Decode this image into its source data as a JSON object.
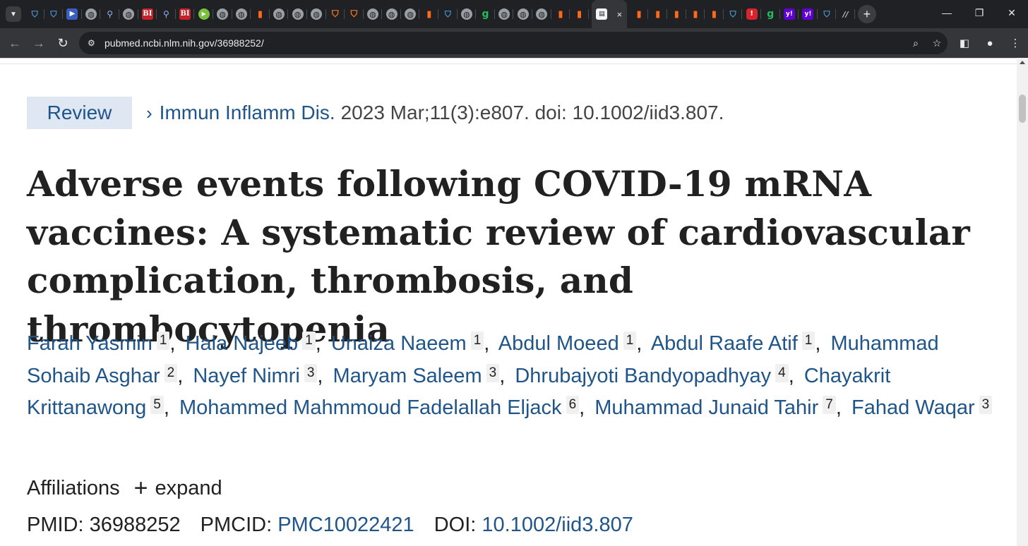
{
  "browser": {
    "tabs": [
      {
        "icon": "shield-icon"
      },
      {
        "icon": "shield-icon"
      },
      {
        "icon": "bookmark-blue-icon"
      },
      {
        "icon": "globe-icon"
      },
      {
        "icon": "search-icon"
      },
      {
        "icon": "globe-icon"
      },
      {
        "icon": "bi-logo-icon"
      },
      {
        "icon": "search-icon"
      },
      {
        "icon": "bi-logo-icon"
      },
      {
        "icon": "play-icon"
      },
      {
        "icon": "globe-icon"
      },
      {
        "icon": "globe-icon"
      },
      {
        "icon": "bookmark-orange-icon"
      },
      {
        "icon": "globe-icon"
      },
      {
        "icon": "globe-icon"
      },
      {
        "icon": "globe-icon"
      },
      {
        "icon": "shield-orange-icon"
      },
      {
        "icon": "shield-orange-icon"
      },
      {
        "icon": "globe-icon"
      },
      {
        "icon": "globe-icon"
      },
      {
        "icon": "globe-icon"
      },
      {
        "icon": "bookmark-orange-icon"
      },
      {
        "icon": "shield-icon"
      },
      {
        "icon": "globe-icon"
      },
      {
        "icon": "grammarly-icon"
      },
      {
        "icon": "globe-icon"
      },
      {
        "icon": "globe-icon"
      },
      {
        "icon": "globe-icon"
      },
      {
        "icon": "bookmark-orange-icon"
      },
      {
        "icon": "bookmark-orange-icon"
      }
    ],
    "active_tab": {
      "icon": "page-icon",
      "close": "×"
    },
    "tabs_after": [
      {
        "icon": "bookmark-orange-icon"
      },
      {
        "icon": "bookmark-orange-icon"
      },
      {
        "icon": "bookmark-orange-icon"
      },
      {
        "icon": "bookmark-orange-icon"
      },
      {
        "icon": "bookmark-orange-icon"
      },
      {
        "icon": "shield-icon"
      },
      {
        "icon": "red-badge-icon"
      },
      {
        "icon": "grammarly-icon"
      },
      {
        "icon": "yahoo-icon"
      },
      {
        "icon": "yahoo-icon"
      },
      {
        "icon": "shield-icon"
      },
      {
        "icon": "slash-icon"
      }
    ],
    "new_tab": "+",
    "url": "pubmed.ncbi.nlm.nih.gov/36988252/"
  },
  "article": {
    "type_badge": "Review",
    "journal": "Immun Inflamm Dis.",
    "citation": "2023 Mar;11(3):e807. doi: 10.1002/iid3.807.",
    "title": "Adverse events following COVID-19 mRNA vaccines: A systematic review of cardiovascular complication, thrombosis, and thrombocytopenia",
    "authors": [
      {
        "name": "Farah Yasmin",
        "aff": "1"
      },
      {
        "name": "Hala Najeeb",
        "aff": "1"
      },
      {
        "name": "Unaiza Naeem",
        "aff": "1"
      },
      {
        "name": "Abdul Moeed",
        "aff": "1"
      },
      {
        "name": "Abdul Raafe Atif",
        "aff": "1"
      },
      {
        "name": "Muhammad Sohaib Asghar",
        "aff": "2"
      },
      {
        "name": "Nayef Nimri",
        "aff": "3"
      },
      {
        "name": "Maryam Saleem",
        "aff": "3"
      },
      {
        "name": "Dhrubajyoti Bandyopadhyay",
        "aff": "4"
      },
      {
        "name": "Chayakrit Krittanawong",
        "aff": "5"
      },
      {
        "name": "Mohammed Mahmmoud Fadelallah Eljack",
        "aff": "6"
      },
      {
        "name": "Muhammad Junaid Tahir",
        "aff": "7"
      },
      {
        "name": "Fahad Waqar",
        "aff": "3"
      }
    ],
    "affiliations_label": "Affiliations",
    "expand_label": "expand",
    "pmid_label": "PMID:",
    "pmid": "36988252",
    "pmcid_label": "PMCID:",
    "pmcid": "PMC10022421",
    "doi_label": "DOI:",
    "doi": "10.1002/iid3.807"
  },
  "colors": {
    "link": "#20558a",
    "badge_bg": "#dfe7f2",
    "chrome_bg": "#202124",
    "toolbar_bg": "#35363a"
  }
}
